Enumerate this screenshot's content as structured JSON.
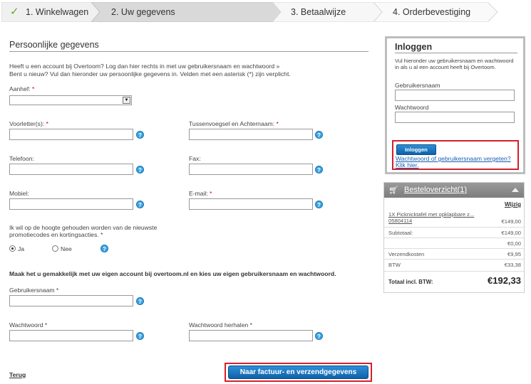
{
  "steps": [
    {
      "num": "1.",
      "label": "Winkelwagen",
      "done": true
    },
    {
      "num": "2.",
      "label": "Uw gegevens",
      "active": true
    },
    {
      "num": "3.",
      "label": "Betaalwijze"
    },
    {
      "num": "4.",
      "label": "Orderbevestiging"
    }
  ],
  "form": {
    "title": "Persoonlijke gegevens",
    "intro_line1": "Heeft u een account bij Overtoom? Log dan hier rechts in met uw gebruikersnaam en wachtwoord »",
    "intro_line2": "Bent u nieuw? Vul dan hieronder uw persoonlijke gegevens in. Velden met een asterisk (*) zijn verplicht.",
    "aanhef": "Aanhef:",
    "voorletters": "Voorletter(s):",
    "tussenvoegsel": "Tussenvoegsel en Achternaam:",
    "telefoon": "Telefoon:",
    "fax": "Fax:",
    "mobiel": "Mobiel:",
    "email": "E-mail:",
    "promo_line1": "Ik wil op de hoogte gehouden worden van de nieuwste",
    "promo_line2": "promotiecodes en kortingsacties.",
    "ja": "Ja",
    "nee": "Nee",
    "account_note": "Maak het u gemakkelijk met uw eigen account bij overtoom.nl en kies uw eigen gebruikersnaam en wachtwoord.",
    "gebruikersnaam": "Gebruikersnaam",
    "wachtwoord": "Wachtwoord",
    "wachtwoord_herhalen": "Wachtwoord herhalen",
    "required_mark": "*",
    "help": "?",
    "terug": "Terug",
    "submit": "Naar factuur- en verzendgegevens"
  },
  "login": {
    "title": "Inloggen",
    "intro": "Vul hieronder uw gebruikersnaam en wachtwoord in als u al een account heeft bij Overtoom.",
    "user_label": "Gebruikersnaam",
    "pass_label": "Wachtwoord",
    "button": "Inloggen",
    "forgot_line1": "Wachtwoord of gebruikersnaam vergeten?",
    "forgot_line2": "Klik hier."
  },
  "order": {
    "title": "Besteloverzicht(1)",
    "wijzig": "Wijzig",
    "product_line1": "1X Picknicktafel met opklapbare z...",
    "product_line2": "05804114",
    "product_price": "€149,00",
    "subtotaal_label": "Subtotaal:",
    "subtotaal": "€149,00",
    "extra": "€0,00",
    "verzendkosten_label": "Verzendkosten",
    "verzendkosten": "€9,95",
    "btw_label": "BTW",
    "btw": "€33,38",
    "total_label": "Totaal incl. BTW:",
    "total": "€192,33"
  },
  "colors": {
    "accent": "#1a6fc0",
    "highlight": "#d4202a",
    "check": "#6ca42c"
  }
}
